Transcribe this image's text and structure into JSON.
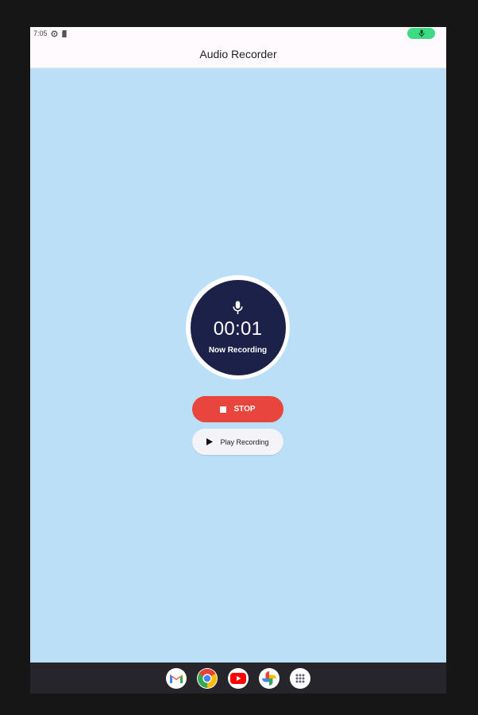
{
  "statusbar": {
    "time": "7:05",
    "icons": [
      "settings-icon",
      "sd-card-icon"
    ],
    "indicator": "mic-active-icon",
    "indicator_color": "#3ddc84"
  },
  "appbar": {
    "title": "Audio Recorder"
  },
  "recorder": {
    "icon": "mic-icon",
    "timer": "00:01",
    "status": "Now Recording",
    "ring_color": "#ffffff",
    "fill_color": "#1b2148"
  },
  "buttons": {
    "stop": {
      "label": "STOP",
      "icon": "stop-icon",
      "color": "#e8453c"
    },
    "play": {
      "label": "Play Recording",
      "icon": "play-icon"
    }
  },
  "dock": {
    "apps": [
      {
        "name": "gmail",
        "icon": "gmail-icon"
      },
      {
        "name": "chrome",
        "icon": "chrome-icon"
      },
      {
        "name": "youtube",
        "icon": "youtube-icon"
      },
      {
        "name": "photos",
        "icon": "photos-icon"
      },
      {
        "name": "app-drawer",
        "icon": "app-drawer-icon"
      }
    ]
  },
  "colors": {
    "background": "#bcdff8",
    "appbar": "#fffafe",
    "dock": "#25252b"
  }
}
